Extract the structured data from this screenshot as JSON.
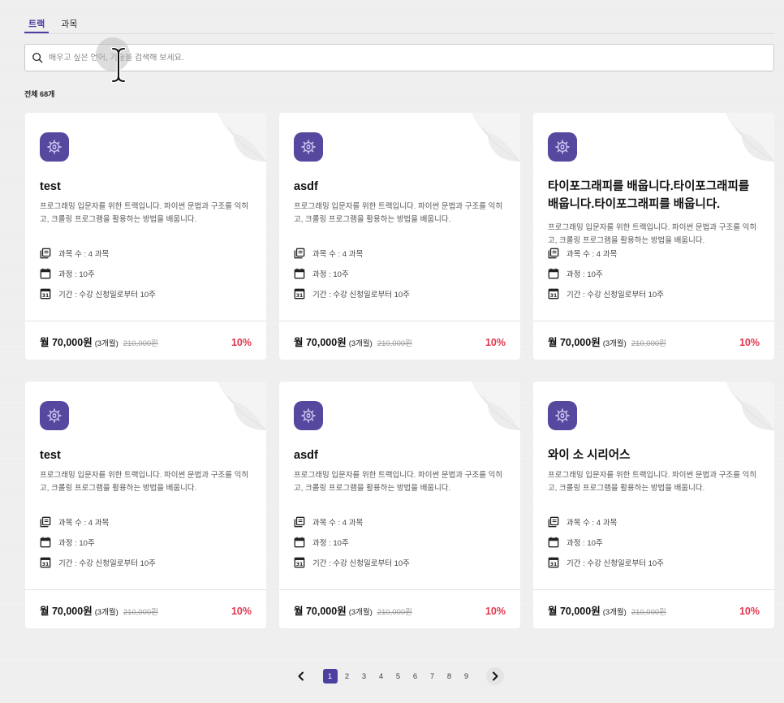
{
  "tabs": [
    {
      "label": "트랙",
      "active": true
    },
    {
      "label": "과목",
      "active": false
    }
  ],
  "search": {
    "placeholder": "배우고 싶은 언어, 기술을 검색해 보세요.",
    "icon": "search-icon"
  },
  "total_label": "전체 68개",
  "colors": {
    "brand": "#56489e",
    "accent": "#4b3fa0",
    "discount": "#e0364e"
  },
  "cards": [
    {
      "title": "test",
      "description": "프로그래밍 입문자를 위한 트랙입니다. 파이썬 문법과 구조를 익히고, 크롤링 프로그램을 활용하는 방법을 배웁니다.",
      "courses": "과목 수 : 4 과목",
      "duration": "과정 : 10주",
      "period": "기간 : 수강 신청일로부터 10주",
      "price": "월 70,000원",
      "price_period": "(3개월)",
      "original_price": "210,000원",
      "discount": "10%"
    },
    {
      "title": "asdf",
      "description": "프로그래밍 입문자를 위한 트랙입니다. 파이썬 문법과 구조를 익히고, 크롤링 프로그램을 활용하는 방법을 배웁니다.",
      "courses": "과목 수 : 4 과목",
      "duration": "과정 : 10주",
      "period": "기간 : 수강 신청일로부터 10주",
      "price": "월 70,000원",
      "price_period": "(3개월)",
      "original_price": "210,000원",
      "discount": "10%"
    },
    {
      "title": "타이포그래피를 배웁니다.타이포그래피를 배웁니다.타이포그래피를 배웁니다.",
      "description": "프로그래밍 입문자를 위한 트랙입니다. 파이썬 문법과 구조를 익히고, 크롤링 프로그램을 활용하는 방법을 배웁니다.",
      "courses": "과목 수 : 4 과목",
      "duration": "과정 : 10주",
      "period": "기간 : 수강 신청일로부터 10주",
      "price": "월 70,000원",
      "price_period": "(3개월)",
      "original_price": "210,000원",
      "discount": "10%"
    },
    {
      "title": "test",
      "description": "프로그래밍 입문자를 위한 트랙입니다. 파이썬 문법과 구조를 익히고, 크롤링 프로그램을 활용하는 방법을 배웁니다.",
      "courses": "과목 수 : 4 과목",
      "duration": "과정 : 10주",
      "period": "기간 : 수강 신청일로부터 10주",
      "price": "월 70,000원",
      "price_period": "(3개월)",
      "original_price": "210,000원",
      "discount": "10%"
    },
    {
      "title": "asdf",
      "description": "프로그래밍 입문자를 위한 트랙입니다. 파이썬 문법과 구조를 익히고, 크롤링 프로그램을 활용하는 방법을 배웁니다.",
      "courses": "과목 수 : 4 과목",
      "duration": "과정 : 10주",
      "period": "기간 : 수강 신청일로부터 10주",
      "price": "월 70,000원",
      "price_period": "(3개월)",
      "original_price": "210,000원",
      "discount": "10%"
    },
    {
      "title": "와이 소 시리어스",
      "description": "프로그래밍 입문자를 위한 트랙입니다. 파이썬 문법과 구조를 익히고, 크롤링 프로그램을 활용하는 방법을 배웁니다.",
      "courses": "과목 수 : 4 과목",
      "duration": "과정 : 10주",
      "period": "기간 : 수강 신청일로부터 10주",
      "price": "월 70,000원",
      "price_period": "(3개월)",
      "original_price": "210,000원",
      "discount": "10%"
    }
  ],
  "pagination": {
    "pages": [
      "1",
      "2",
      "3",
      "4",
      "5",
      "6",
      "7",
      "8",
      "9"
    ],
    "current": "1",
    "prev_icon": "chevron-left-icon",
    "next_icon": "chevron-right-icon"
  }
}
